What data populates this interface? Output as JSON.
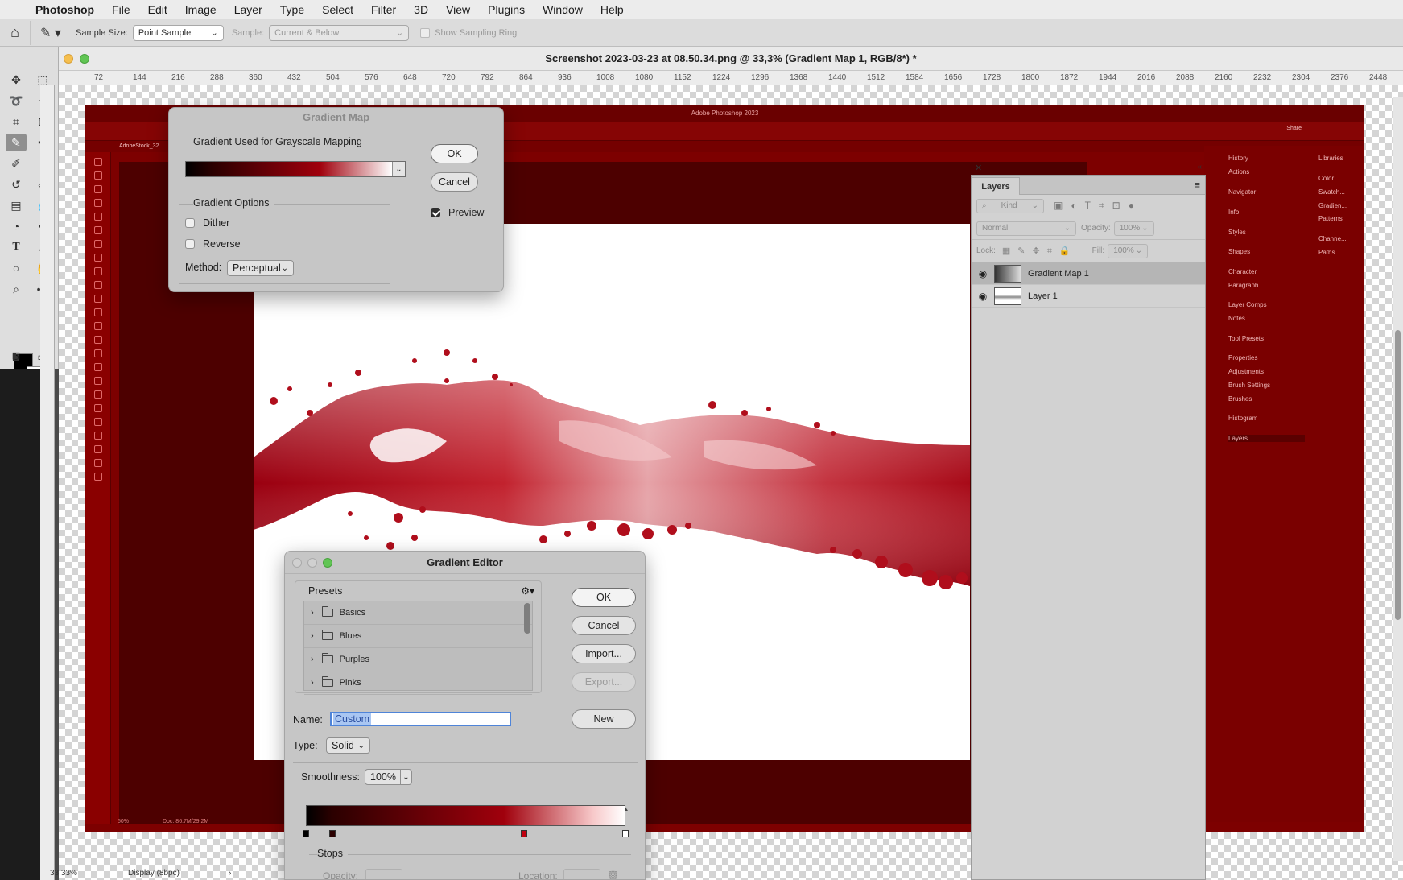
{
  "menubar": {
    "app": "Photoshop",
    "items": [
      "File",
      "Edit",
      "Image",
      "Layer",
      "Type",
      "Select",
      "Filter",
      "3D",
      "View",
      "Plugins",
      "Window",
      "Help"
    ]
  },
  "optionsbar": {
    "sample_size_label": "Sample Size:",
    "sample_size_value": "Point Sample",
    "sample_label": "Sample:",
    "sample_value": "Current & Below",
    "show_ring": "Show Sampling Ring"
  },
  "document": {
    "title": "Screenshot 2023-03-23 at 08.50.34.png @ 33,3% (Gradient Map 1, RGB/8*) *",
    "ruler_ticks": [
      "72",
      "144",
      "216",
      "288",
      "360",
      "432",
      "504",
      "576",
      "648",
      "720",
      "792",
      "864",
      "936",
      "1008",
      "1080",
      "1152",
      "1224",
      "1296",
      "1368",
      "1440",
      "1512",
      "1584",
      "1656",
      "1728",
      "1800",
      "1872",
      "1944",
      "2016",
      "2088",
      "2160",
      "2232",
      "2304",
      "2376",
      "2448"
    ]
  },
  "inner_screenshot": {
    "app_title": "Adobe Photoshop 2023",
    "tab": "AdobeStock_32",
    "share": "Share",
    "status_zoom": "50%",
    "status_doc": "Doc: 86.7M/29.2M",
    "panels_col1": [
      "History",
      "Actions",
      "Navigator",
      "Info",
      "Styles",
      "Shapes",
      "Character",
      "Paragraph",
      "Layer Comps",
      "Notes",
      "Tool Presets",
      "Properties",
      "Adjustments",
      "Brush Settings",
      "Brushes",
      "Histogram",
      "Layers"
    ],
    "panels_col2": [
      "Libraries",
      "Color",
      "Swatch...",
      "Gradien...",
      "Patterns",
      "Channe...",
      "Paths"
    ]
  },
  "layers_panel": {
    "tab": "Layers",
    "kind": "Kind",
    "blend": "Normal",
    "opacity_label": "Opacity:",
    "opacity_value": "100%",
    "lock_label": "Lock:",
    "fill_label": "Fill:",
    "fill_value": "100%",
    "layers": [
      {
        "name": "Gradient Map 1",
        "selected": true
      },
      {
        "name": "Layer 1",
        "selected": false
      }
    ]
  },
  "gradient_map": {
    "title": "Gradient Map",
    "group1": "Gradient Used for Grayscale Mapping",
    "group2": "Gradient Options",
    "dither": "Dither",
    "reverse": "Reverse",
    "method_label": "Method:",
    "method_value": "Perceptual",
    "ok": "OK",
    "cancel": "Cancel",
    "preview": "Preview",
    "preview_checked": true
  },
  "gradient_editor": {
    "title": "Gradient Editor",
    "presets_label": "Presets",
    "presets": [
      "Basics",
      "Blues",
      "Purples",
      "Pinks"
    ],
    "ok": "OK",
    "cancel": "Cancel",
    "import": "Import...",
    "export": "Export...",
    "name_label": "Name:",
    "name_value": "Custom",
    "new": "New",
    "type_label": "Type:",
    "type_value": "Solid",
    "smoothness_label": "Smoothness:",
    "smoothness_value": "100%",
    "stops_label": "Stops",
    "opacity_label": "Opacity:",
    "location_label": "Location:",
    "gradient_colors": [
      "#000000",
      "#2b0000",
      "#a0000c",
      "#ffffff"
    ]
  },
  "statusbar": {
    "zoom": "33,33%",
    "display": "Display (8bpc)"
  },
  "colors": {
    "accent_red": "#7d0000",
    "selection_blue": "#4f84d8"
  }
}
